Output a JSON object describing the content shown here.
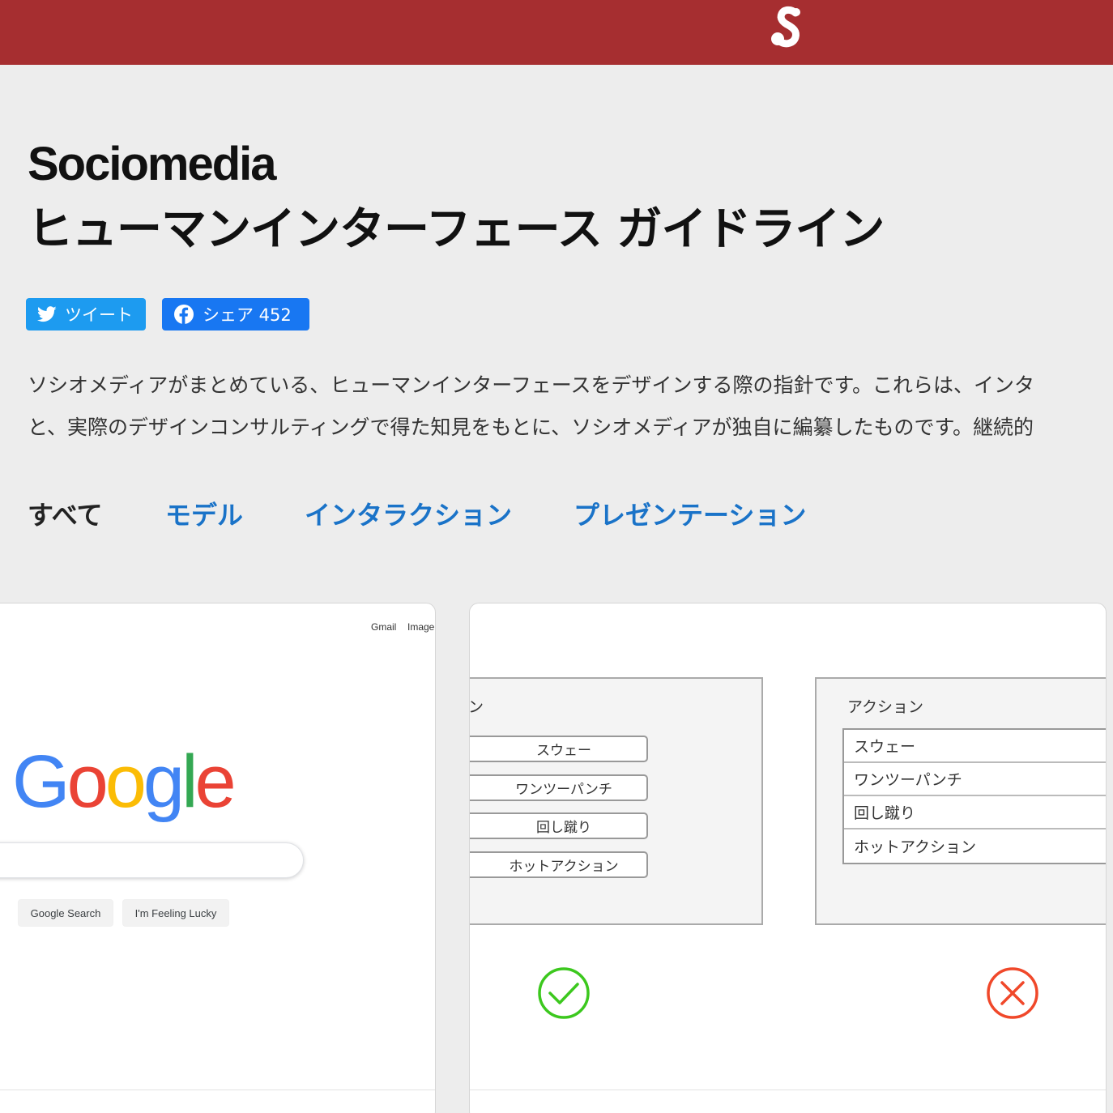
{
  "header": {
    "brand_color": "#a62e30",
    "logo_icon": "sociomedia-s-logo"
  },
  "hero": {
    "brand": "Sociomedia",
    "title": "ヒューマンインターフェース ガイドライン"
  },
  "share": {
    "tweet_label": "ツイート",
    "share_label": "シェア 452"
  },
  "lead": {
    "line1": "ソシオメディアがまとめている、ヒューマンインターフェースをデザインする際の指針です。これらは、インタ",
    "line2": "と、実際のデザインコンサルティングで得た知見をもとに、ソシオメディアが独自に編纂したものです。継続的"
  },
  "tabs": {
    "all": "すべて",
    "model": "モデル",
    "interaction": "インタラクション",
    "presentation": "プレゼンテーション"
  },
  "card1": {
    "gmail": "Gmail",
    "images": "Image",
    "logo_letters": [
      "G",
      "o",
      "o",
      "g",
      "l",
      "e"
    ],
    "logo_colors": [
      "#4285f4",
      "#ea4335",
      "#fbbc05",
      "#4285f4",
      "#34a853",
      "#ea4335"
    ],
    "search_button": "Google Search",
    "lucky_button": "I'm Feeling Lucky"
  },
  "card2": {
    "left_panel_title": "ン",
    "left_buttons": [
      "スウェー",
      "ワンツーパンチ",
      "回し蹴り",
      "ホットアクション"
    ],
    "right_panel_title": "アクション",
    "right_list": [
      "スウェー",
      "ワンツーパンチ",
      "回し蹴り",
      "ホットアクション"
    ],
    "ok_icon": "check-circle-icon",
    "ng_icon": "cross-circle-icon",
    "ok_color": "#3cc81e",
    "ng_color": "#f0482a"
  }
}
